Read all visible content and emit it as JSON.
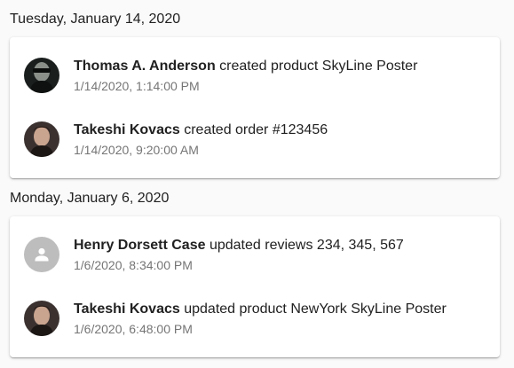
{
  "groups": [
    {
      "date": "Tuesday, January 14, 2020",
      "events": [
        {
          "actor": "Thomas A. Anderson",
          "action": "created product SkyLine Poster",
          "time": "1/14/2020, 1:14:00 PM",
          "avatar": "photo"
        },
        {
          "actor": "Takeshi Kovacs",
          "action": "created order #123456",
          "time": "1/14/2020, 9:20:00 AM",
          "avatar": "photo"
        }
      ]
    },
    {
      "date": "Monday, January 6, 2020",
      "events": [
        {
          "actor": "Henry Dorsett Case",
          "action": "updated reviews 234, 345, 567",
          "time": "1/6/2020, 8:34:00 PM",
          "avatar": "person-placeholder-icon"
        },
        {
          "actor": "Takeshi Kovacs",
          "action": "updated product NewYork SkyLine Poster",
          "time": "1/6/2020, 6:48:00 PM",
          "avatar": "photo"
        }
      ]
    }
  ],
  "colors": {
    "background": "#fafafa",
    "card": "#ffffff",
    "primary_text": "#212121",
    "secondary_text": "#757575",
    "placeholder_avatar": "#bdbdbd"
  }
}
